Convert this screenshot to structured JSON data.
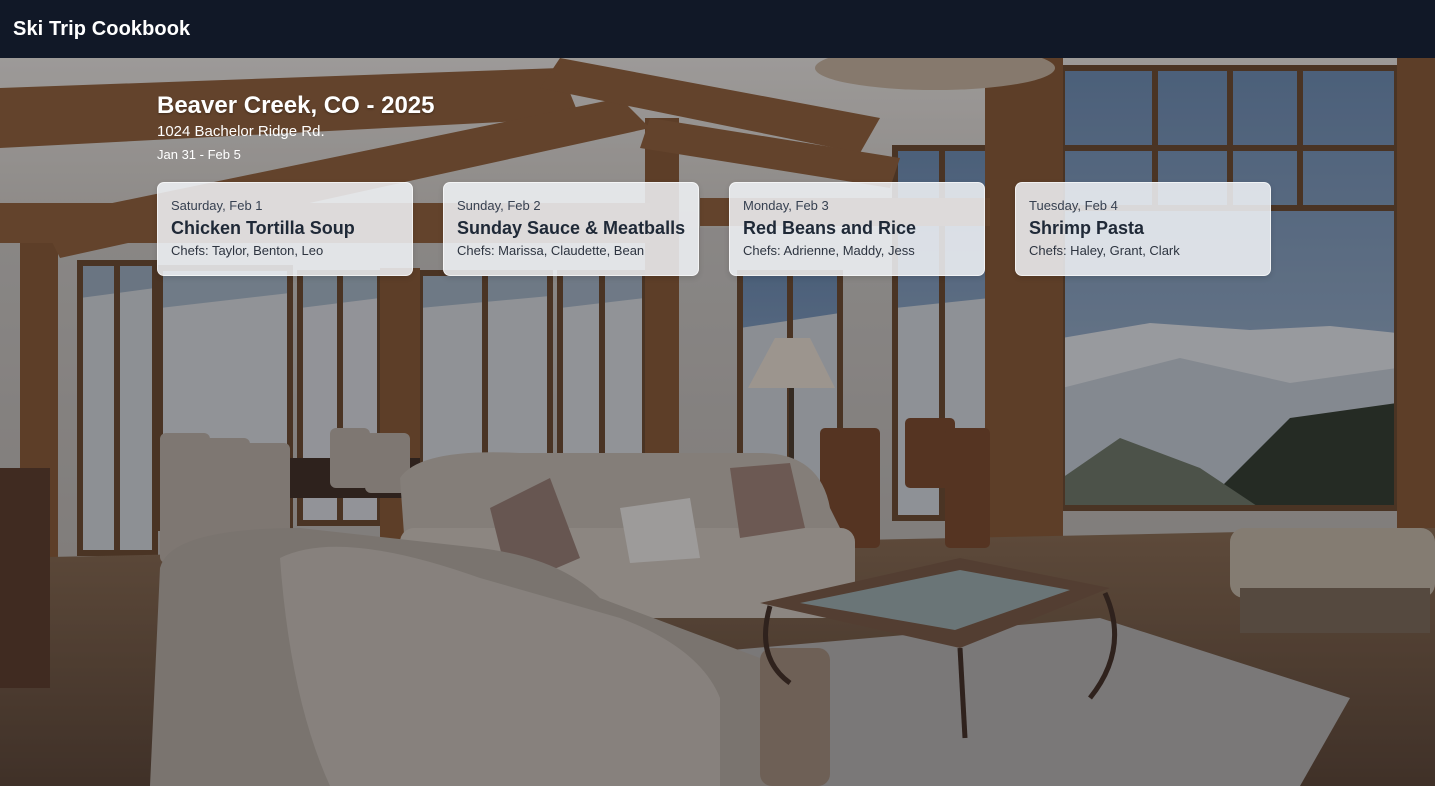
{
  "app": {
    "title": "Ski Trip Cookbook"
  },
  "trip": {
    "name": "Beaver Creek, CO - 2025",
    "address": "1024 Bachelor Ridge Rd.",
    "dates": "Jan 31 - Feb 5"
  },
  "meals": [
    {
      "day": "Saturday, Feb 1",
      "dish": "Chicken Tortilla Soup",
      "chefs": "Chefs: Taylor, Benton, Leo"
    },
    {
      "day": "Sunday, Feb 2",
      "dish": "Sunday Sauce & Meatballs",
      "chefs": "Chefs: Marissa, Claudette, Bean"
    },
    {
      "day": "Monday, Feb 3",
      "dish": "Red Beans and Rice",
      "chefs": "Chefs: Adrienne, Maddy, Jess"
    },
    {
      "day": "Tuesday, Feb 4",
      "dish": "Shrimp Pasta",
      "chefs": "Chefs: Haley, Grant, Clark"
    }
  ],
  "colors": {
    "topbar": "#111827",
    "card_background": "#f1f3f7",
    "card_text": "#1f2937"
  }
}
